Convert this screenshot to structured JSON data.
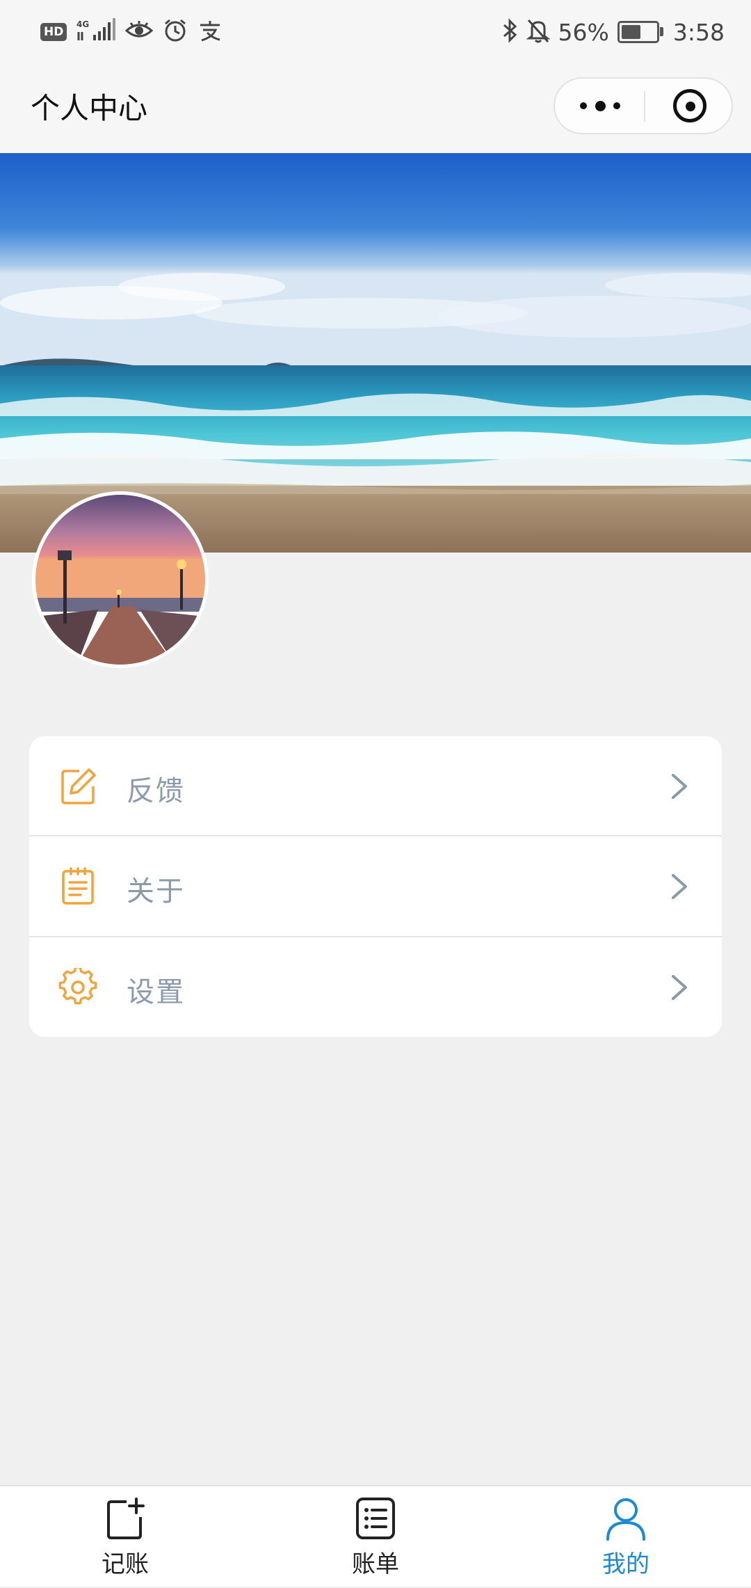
{
  "status_bar": {
    "hd": "HD",
    "network": "4G",
    "battery_percent": "56%",
    "battery_level": 0.56,
    "time": "3:58",
    "icons": [
      "signal-icon",
      "eye-icon",
      "alarm-icon",
      "alipay-icon",
      "bluetooth-icon",
      "mute-bell-icon",
      "battery-icon"
    ]
  },
  "header": {
    "title": "个人中心",
    "capsule_icons": [
      "more-icon",
      "close-target-icon"
    ]
  },
  "banner": {
    "icon": "ocean-beach-image"
  },
  "profile": {
    "avatar_icon": "sunset-pier-avatar"
  },
  "menu": {
    "items": [
      {
        "label": "反馈",
        "icon": "edit-icon"
      },
      {
        "label": "关于",
        "icon": "notepad-icon"
      },
      {
        "label": "设置",
        "icon": "gear-icon"
      }
    ],
    "chevron_icon": "chevron-right-icon"
  },
  "tabs": [
    {
      "label": "记账",
      "icon": "add-note-icon",
      "active": false
    },
    {
      "label": "账单",
      "icon": "bill-list-icon",
      "active": false
    },
    {
      "label": "我的",
      "icon": "user-icon",
      "active": true
    }
  ],
  "colors": {
    "accent_orange": "#f2a33a",
    "tab_active": "#1a8ad6",
    "menu_text": "#8b9bab",
    "chevron": "#8a9aa9"
  }
}
